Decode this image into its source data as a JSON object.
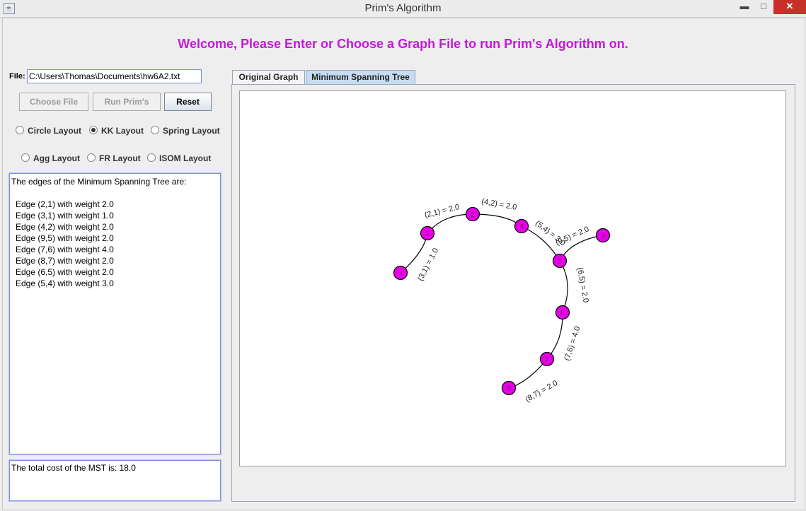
{
  "window": {
    "title": "Prim's Algorithm",
    "minimize": "▬",
    "maximize": "□",
    "close": "✕"
  },
  "welcome": "Welcome, Please Enter or Choose a Graph File to run Prim's Algorithm on.",
  "file": {
    "label": "File:",
    "value": "C:\\Users\\Thomas\\Documents\\hw6A2.txt"
  },
  "buttons": {
    "choose": "Choose File",
    "run": "Run Prim's",
    "reset": "Reset"
  },
  "layouts": [
    {
      "label": "Circle Layout",
      "checked": false
    },
    {
      "label": "KK Layout",
      "checked": true
    },
    {
      "label": "Spring Layout",
      "checked": false
    },
    {
      "label": "Agg Layout",
      "checked": false
    },
    {
      "label": "FR Layout",
      "checked": false
    },
    {
      "label": "ISOM Layout",
      "checked": false
    }
  ],
  "edges_text": {
    "header": "The edges of the Minimum Spanning Tree are:",
    "lines": [
      "Edge (2,1) with weight 2.0",
      "Edge (3,1) with weight 1.0",
      "Edge (4,2) with weight 2.0",
      "Edge (9,5) with weight 2.0",
      "Edge (7,6) with weight 4.0",
      "Edge (8,7) with weight 2.0",
      "Edge (6,5) with weight 2.0",
      "Edge (5,4) with weight 3.0"
    ]
  },
  "cost_text": "The total cost of the MST is: 18.0",
  "tabs": {
    "original": "Original Graph",
    "mst": "Minimum Spanning Tree"
  },
  "graph": {
    "node_color": "#e600e6",
    "nodes": [
      "1",
      "2",
      "3",
      "4",
      "5",
      "6",
      "7",
      "8",
      "9"
    ],
    "edge_labels": [
      "(2,1) = 2.0",
      "(4,2) = 2.0",
      "(3,1) = 1.0",
      "(5,4) = 3.0",
      "(9,5) = 2.0",
      "(6,5) = 2.0",
      "(7,6) = 4.0",
      "(8,7) = 2.0"
    ]
  }
}
